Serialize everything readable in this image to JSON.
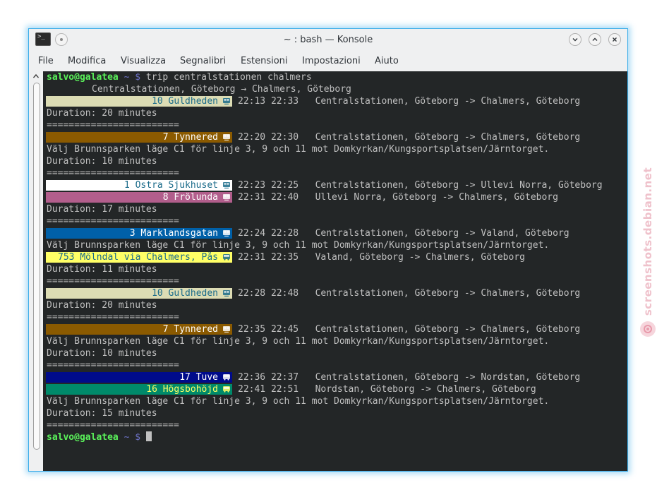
{
  "window": {
    "title": "~ : bash — Konsole",
    "accent": "#3daee9"
  },
  "menu": [
    "File",
    "Modifica",
    "Visualizza",
    "Segnalibri",
    "Estensioni",
    "Impostazioni",
    "Aiuto"
  ],
  "terminal": {
    "prompt_user": "salvo@galatea",
    "prompt_path": "~ $",
    "command": "trip centralstationen chalmers",
    "header": "Centralstationen, Göteborg → Chalmers, Göteborg",
    "separator": "========================",
    "final_prompt_user": "salvo@galatea",
    "final_prompt_path": "~ $"
  },
  "trips": [
    {
      "legs": [
        {
          "label": "10 Guldheden",
          "icon": "tram-icon",
          "bg": "#dcdcb4",
          "fg": "#1a6b8a",
          "times": "22:13 22:33",
          "route": "Centralstationen, Göteborg -> Chalmers, Göteborg"
        }
      ],
      "notes": [],
      "duration": "Duration: 20 minutes"
    },
    {
      "legs": [
        {
          "label": "7 Tynnered",
          "icon": "tram-icon",
          "bg": "#8b5a00",
          "fg": "#ffffff",
          "times": "22:20 22:30",
          "route": "Centralstationen, Göteborg -> Chalmers, Göteborg"
        }
      ],
      "notes": [
        "Välj Brunnsparken läge C1 för linje 3, 9 och 11 mot Domkyrkan/Kungsportsplatsen/Järntorget."
      ],
      "duration": "Duration: 10 minutes"
    },
    {
      "legs": [
        {
          "label": "1 Östra Sjukhuset",
          "icon": "tram-icon",
          "bg": "#ffffff",
          "fg": "#1a6b8a",
          "times": "22:23 22:25",
          "route": "Centralstationen, Göteborg -> Ullevi Norra, Göteborg"
        },
        {
          "label": "8 Frölunda",
          "icon": "tram-icon",
          "bg": "#b25e8c",
          "fg": "#ffffff",
          "times": "22:31 22:40",
          "route": "Ullevi Norra, Göteborg -> Chalmers, Göteborg"
        }
      ],
      "notes": [],
      "duration": "Duration: 17 minutes"
    },
    {
      "legs": [
        {
          "label": "3 Marklandsgatan",
          "icon": "tram-icon",
          "bg": "#0060a8",
          "fg": "#ffffff",
          "times": "22:24 22:28",
          "route": "Centralstationen, Göteborg -> Valand, Göteborg"
        }
      ],
      "notes": [
        "Välj Brunnsparken läge C1 för linje 3, 9 och 11 mot Domkyrkan/Kungsportsplatsen/Järntorget."
      ],
      "legs2": [
        {
          "label": "753 Mölndal via Chalmers, Pås",
          "icon": "bus-icon",
          "bg": "#ffff66",
          "fg": "#1a6b8a",
          "times": "22:31 22:35",
          "route": "Valand, Göteborg -> Chalmers, Göteborg"
        }
      ],
      "duration": "Duration: 11 minutes"
    },
    {
      "legs": [
        {
          "label": "10 Guldheden",
          "icon": "tram-icon",
          "bg": "#dcdcb4",
          "fg": "#1a6b8a",
          "times": "22:28 22:48",
          "route": "Centralstationen, Göteborg -> Chalmers, Göteborg"
        }
      ],
      "notes": [],
      "duration": "Duration: 20 minutes"
    },
    {
      "legs": [
        {
          "label": "7 Tynnered",
          "icon": "tram-icon",
          "bg": "#8b5a00",
          "fg": "#ffffff",
          "times": "22:35 22:45",
          "route": "Centralstationen, Göteborg -> Chalmers, Göteborg"
        }
      ],
      "notes": [
        "Välj Brunnsparken läge C1 för linje 3, 9 och 11 mot Domkyrkan/Kungsportsplatsen/Järntorget."
      ],
      "duration": "Duration: 10 minutes"
    },
    {
      "legs": [
        {
          "label": "17 Tuve",
          "icon": "bus-icon",
          "bg": "#000b8a",
          "fg": "#ffffff",
          "times": "22:36 22:37",
          "route": "Centralstationen, Göteborg -> Nordstan, Göteborg"
        },
        {
          "label": "16 Högsbohöjd",
          "icon": "bus-icon",
          "bg": "#008a6a",
          "fg": "#ffff66",
          "times": "22:41 22:51",
          "route": "Nordstan, Göteborg -> Chalmers, Göteborg"
        }
      ],
      "notes": [
        "Välj Brunnsparken läge C1 för linje 3, 9 och 11 mot Domkyrkan/Kungsportsplatsen/Järntorget."
      ],
      "duration": "Duration: 15 minutes"
    }
  ],
  "watermark": "screenshots.debian.net"
}
